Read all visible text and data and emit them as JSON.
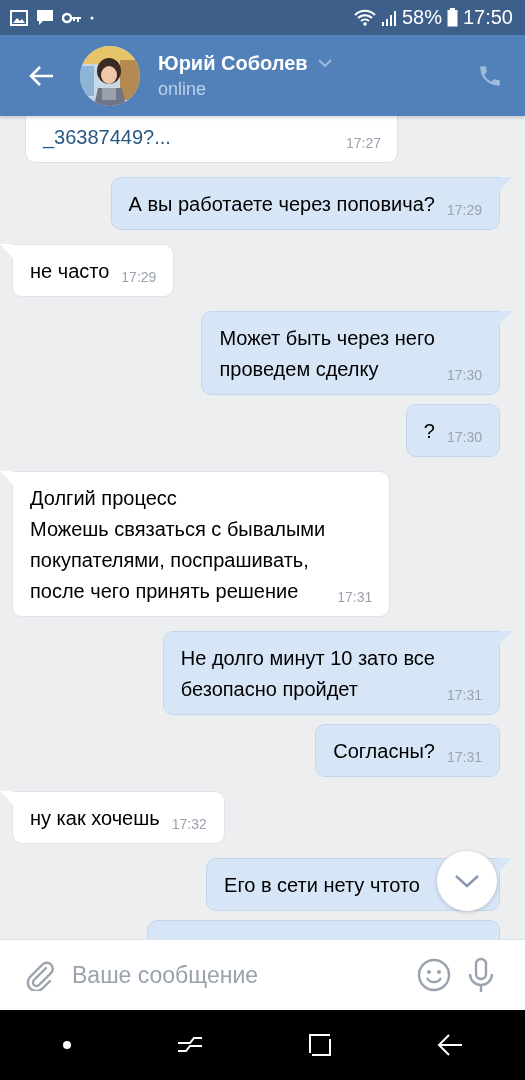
{
  "status_bar": {
    "battery": "58%",
    "time": "17:50"
  },
  "header": {
    "name": "Юрий Соболев",
    "status": "online"
  },
  "messages": [
    {
      "kind": "incoming",
      "tail": false,
      "cut": true,
      "text": "_36387449?...",
      "time": "17:27"
    },
    {
      "kind": "outgoing",
      "tail": true,
      "cut": false,
      "text": "А вы работаете через поповича?",
      "time": "17:29"
    },
    {
      "kind": "incoming",
      "tail": true,
      "cut": false,
      "text": "не часто",
      "time": "17:29"
    },
    {
      "kind": "outgoing",
      "tail": true,
      "cut": false,
      "text": "Может быть через него\nпроведем сделку",
      "time": "17:30"
    },
    {
      "kind": "outgoing",
      "tail": false,
      "cut": false,
      "text": "?",
      "time": "17:30"
    },
    {
      "kind": "incoming",
      "tail": true,
      "cut": false,
      "text": "Долгий процесс\nМожешь связаться с бывалыми\nпокупателями, поспрашивать,\nпосле чего принять решение",
      "time": "17:31"
    },
    {
      "kind": "outgoing",
      "tail": true,
      "cut": false,
      "text": "Не долго минут 10 зато все\nбезопасно пройдет",
      "time": "17:31"
    },
    {
      "kind": "outgoing",
      "tail": false,
      "cut": false,
      "text": "Согласны?",
      "time": "17:31"
    },
    {
      "kind": "incoming",
      "tail": true,
      "cut": false,
      "text": "ну как хочешь",
      "time": "17:32"
    },
    {
      "kind": "outgoing",
      "tail": true,
      "cut": false,
      "text": "Его в сети нету чтото"
    }
  ],
  "composer": {
    "placeholder": "Ваше сообщение"
  }
}
